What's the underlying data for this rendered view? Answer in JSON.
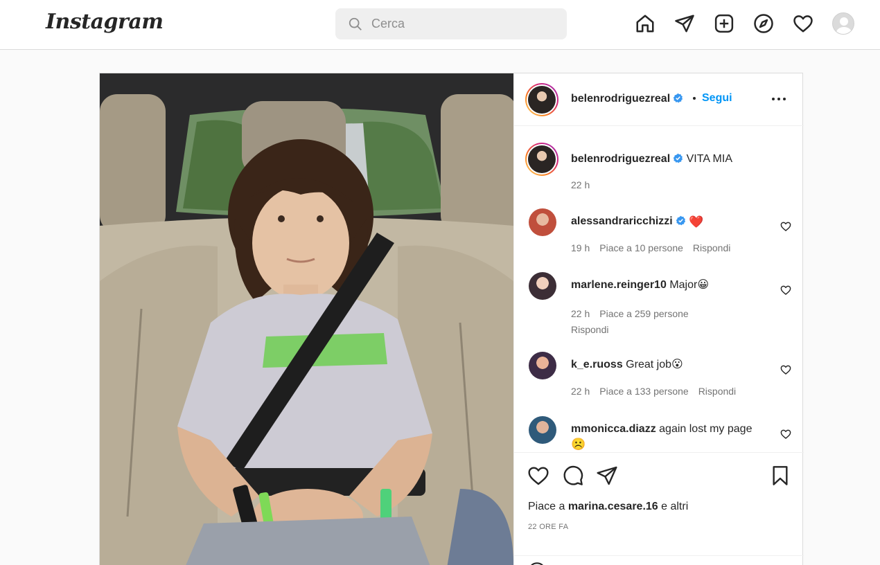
{
  "header": {
    "logo_text": "Instagram",
    "search_placeholder": "Cerca"
  },
  "icons": {
    "home": "home-icon",
    "direct": "send-icon",
    "new_post": "plus-square-icon",
    "explore": "compass-icon",
    "activity": "heart-icon",
    "profile": "avatar"
  },
  "post": {
    "author": "belenrodriguezreal",
    "follow_label": "Segui",
    "caption_author": "belenrodriguezreal",
    "caption_text": "VITA MIA",
    "caption_time": "22 h",
    "comments": [
      {
        "user": "alessandraricchizzi",
        "text": "❤️",
        "time": "19 h",
        "likes": "Piace a 10 persone",
        "reply": "Rispondi"
      },
      {
        "user": "marlene.reinger10",
        "text": "Major😀",
        "time": "22 h",
        "likes": "Piace a 259 persone",
        "reply": "Rispondi"
      },
      {
        "user": "k_e.ruoss",
        "text": "Great job😮",
        "time": "22 h",
        "likes": "Piace a 133 persone",
        "reply": "Rispondi"
      },
      {
        "user": "mmonicca.diazz",
        "text": "again lost my page",
        "text2": "☹️"
      }
    ],
    "likes_prefix": "Piace a ",
    "likes_user": "marina.cesare.16",
    "likes_suffix": " e altri",
    "time_ago": "22 ORE FA"
  },
  "colors": {
    "accent": "#0095f6",
    "verified": "#3897f0",
    "border": "#dbdbdb",
    "muted": "#737373"
  }
}
